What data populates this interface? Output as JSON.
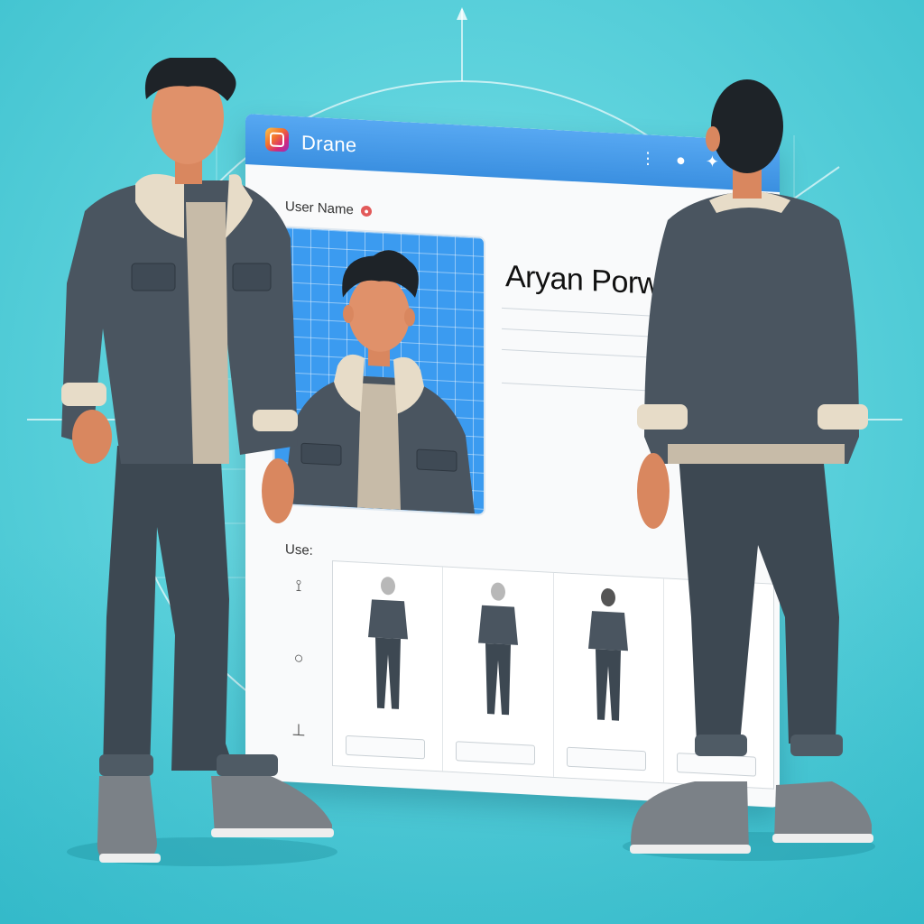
{
  "app": {
    "name": "Drane"
  },
  "profile": {
    "username_label": "User Name",
    "full_name": "Aryan Porwals",
    "fields": [
      {
        "label": "",
        "value": ""
      },
      {
        "label": "",
        "value": ""
      },
      {
        "label": "",
        "value": ""
      },
      {
        "label": "",
        "value": ""
      }
    ],
    "use_label": "Use:"
  },
  "views": [
    {
      "caption": "",
      "button": ""
    },
    {
      "caption": "",
      "button": ""
    },
    {
      "caption": "",
      "button": ""
    },
    {
      "caption": "",
      "button": ""
    }
  ],
  "icons": {
    "titlebar": [
      "more-vertical-icon",
      "apple-icon",
      "twitter-icon",
      "twitter-icon"
    ],
    "side_tools": [
      "pin-icon",
      "circle-icon",
      "stand-icon"
    ]
  },
  "colors": {
    "background": "#5fd3dd",
    "titlebar": "#3a8fe0",
    "jacket": "#4a5560",
    "collar": "#e7dcc8",
    "jeans": "#3d4852",
    "skin": "#e0916a",
    "hair": "#1e2328"
  }
}
